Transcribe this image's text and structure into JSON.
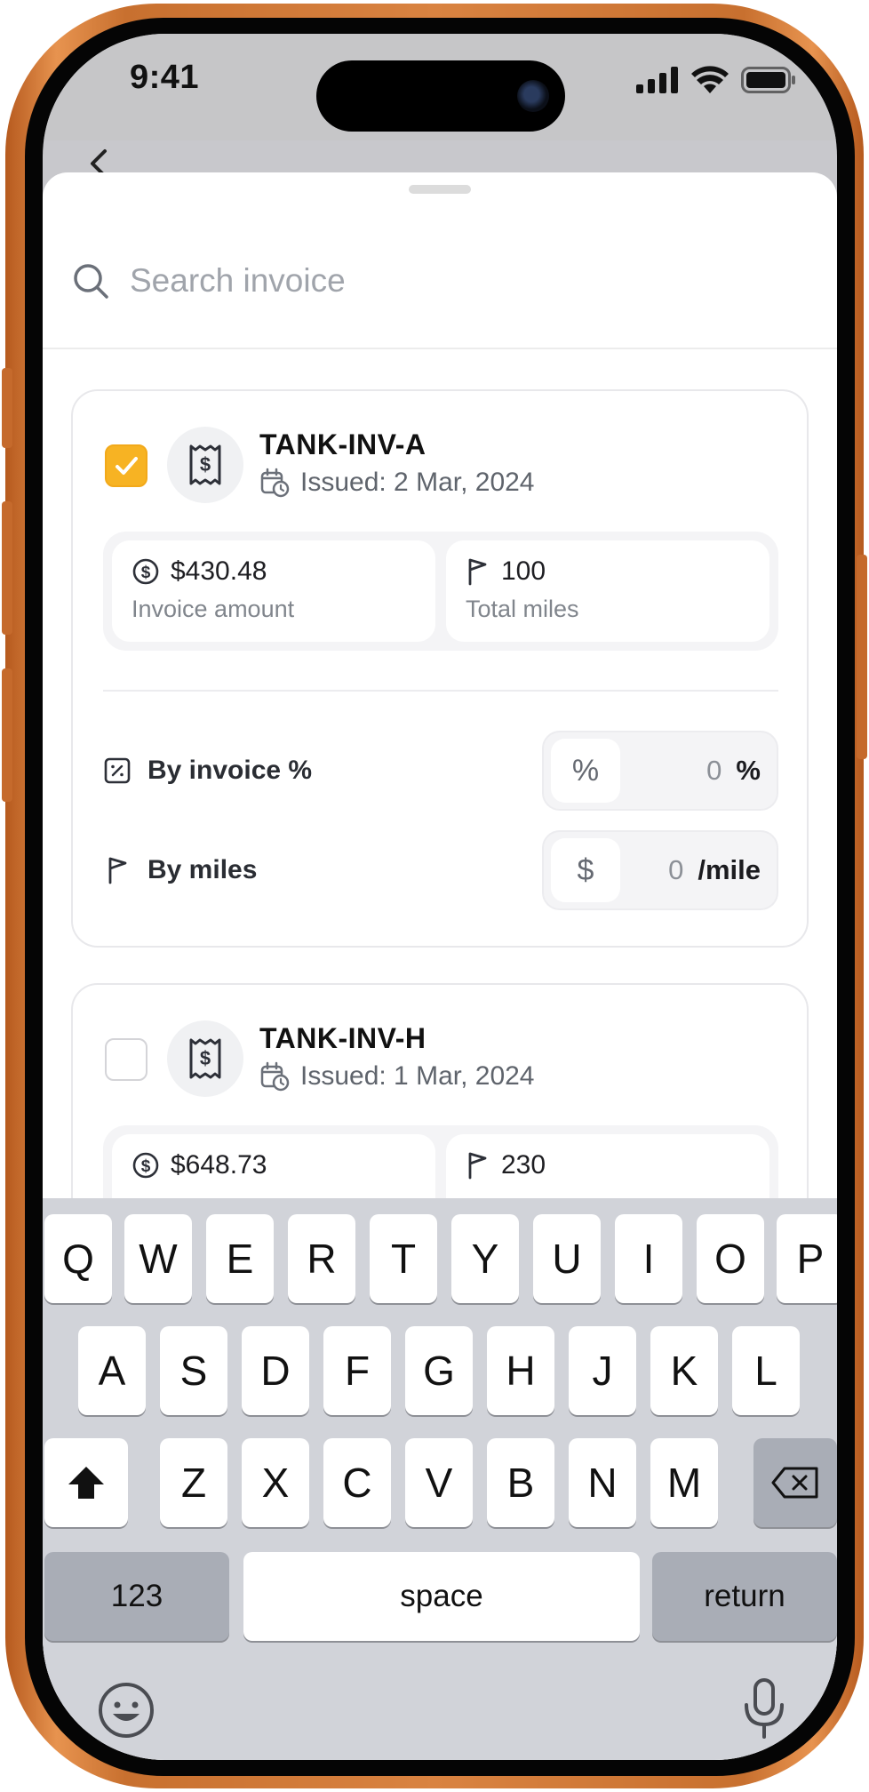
{
  "status": {
    "time": "9:41"
  },
  "search": {
    "placeholder": "Search invoice"
  },
  "invoices": [
    {
      "id": "TANK-INV-A",
      "issued": "Issued: 2 Mar, 2024",
      "checked": true,
      "amount": "$430.48",
      "amount_label": "Invoice amount",
      "miles": "100",
      "miles_label": "Total miles",
      "options": [
        {
          "label": "By invoice %",
          "button": "%",
          "value": "0",
          "unit": "%"
        },
        {
          "label": "By miles",
          "button": "$",
          "value": "0",
          "unit": "/mile"
        }
      ]
    },
    {
      "id": "TANK-INV-H",
      "issued": "Issued: 1 Mar, 2024",
      "checked": false,
      "amount": "$648.73",
      "miles": "230"
    }
  ],
  "keyboard": {
    "row1": [
      "Q",
      "W",
      "E",
      "R",
      "T",
      "Y",
      "U",
      "I",
      "O",
      "P"
    ],
    "row2": [
      "A",
      "S",
      "D",
      "F",
      "G",
      "H",
      "J",
      "K",
      "L"
    ],
    "row3": [
      "Z",
      "X",
      "C",
      "V",
      "B",
      "N",
      "M"
    ],
    "numbers_key": "123",
    "space_key": "space",
    "return_key": "return"
  },
  "colors": {
    "accent": "#f7b323",
    "frame": "#d98341"
  },
  "icons": [
    "search-icon",
    "receipt-dollar-icon",
    "calendar-clock-icon",
    "dollar-circle-icon",
    "flag-icon",
    "percent-square-icon",
    "shift-icon",
    "backspace-icon",
    "emoji-icon",
    "microphone-icon",
    "back-chevron-icon"
  ]
}
